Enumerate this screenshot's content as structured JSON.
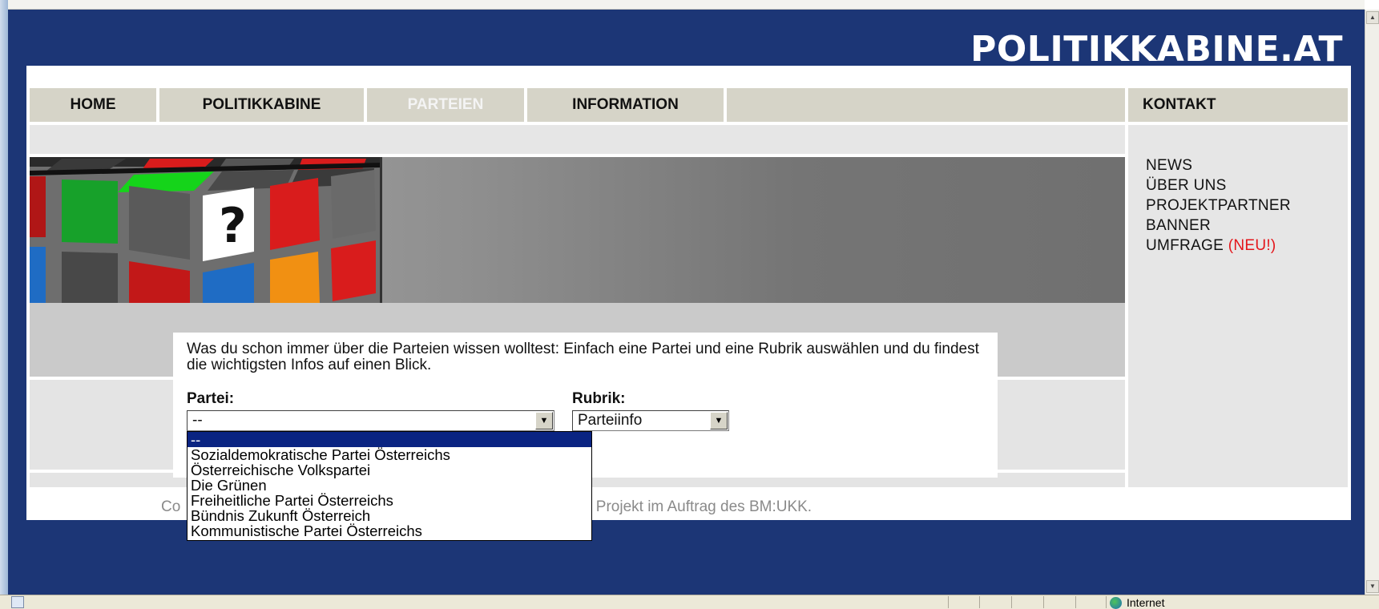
{
  "site": {
    "logo": "POLITIKKABINE.AT"
  },
  "nav": {
    "items": [
      {
        "label": "HOME"
      },
      {
        "label": "POLITIKKABINE"
      },
      {
        "label": "PARTEIEN",
        "active": true
      },
      {
        "label": "INFORMATION"
      }
    ],
    "contact": "KONTAKT"
  },
  "sidebar": {
    "items": [
      {
        "label": "NEWS"
      },
      {
        "label": "ÜBER UNS"
      },
      {
        "label": "PROJEKTPARTNER"
      },
      {
        "label": "BANNER"
      },
      {
        "label": "UMFRAGE",
        "badge": "(NEU!)"
      }
    ],
    "badge_color": "#e4151a"
  },
  "content": {
    "intro": "Was du schon immer über die Parteien wissen wolltest: Einfach eine Partei und eine Rubrik auswählen und du findest die wichtigsten Infos auf einen Blick.",
    "party_label": "Partei:",
    "party_value": "--",
    "category_label": "Rubrik:",
    "category_value": "Parteiinfo"
  },
  "party_options": [
    "--",
    "Sozialdemokratische Partei Österreichs",
    "Österreichische Volkspartei",
    "Die Grünen",
    "Freiheitliche Partei Österreichs",
    "Bündnis Zukunft Österreich",
    "Kommunistische Partei Österreichs"
  ],
  "footer": {
    "left": "Co",
    "right": "s. Ein Projekt im Auftrag des BM:UKK."
  },
  "statusbar": {
    "zone": "Internet"
  },
  "colors": {
    "header_bg": "#1c3676",
    "nav_bg": "#d6d4c8",
    "selected_option": "#0a2482"
  }
}
